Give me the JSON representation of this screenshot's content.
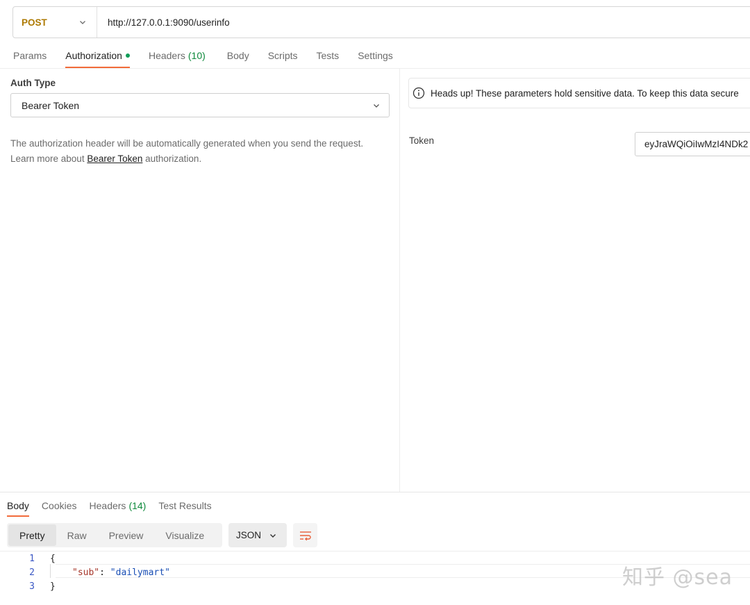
{
  "request": {
    "method": "POST",
    "url": "http://127.0.0.1:9090/userinfo"
  },
  "request_tabs": [
    {
      "label": "Params"
    },
    {
      "label": "Authorization",
      "active": true,
      "indicator": "green-dot"
    },
    {
      "label": "Headers",
      "count": "(10)"
    },
    {
      "label": "Body"
    },
    {
      "label": "Scripts"
    },
    {
      "label": "Tests"
    },
    {
      "label": "Settings"
    }
  ],
  "auth": {
    "type_label": "Auth Type",
    "type_value": "Bearer Token",
    "help_line1": "The authorization header will be automatically generated when you send the request.",
    "help_prefix": "Learn more about ",
    "help_link": "Bearer Token",
    "help_suffix": " authorization.",
    "notice": "Heads up! These parameters hold sensitive data. To keep this data secure",
    "token_label": "Token",
    "token_value": "eyJraWQiOiIwMzI4NDk2"
  },
  "response_tabs": [
    {
      "label": "Body",
      "active": true
    },
    {
      "label": "Cookies"
    },
    {
      "label": "Headers",
      "count": "(14)"
    },
    {
      "label": "Test Results"
    }
  ],
  "view_modes": [
    {
      "label": "Pretty",
      "active": true
    },
    {
      "label": "Raw"
    },
    {
      "label": "Preview"
    },
    {
      "label": "Visualize"
    }
  ],
  "format": "JSON",
  "code": {
    "line_numbers": [
      "1",
      "2",
      "3"
    ],
    "open_brace": "{",
    "key": "\"sub\"",
    "colon": ": ",
    "value": "\"dailymart\"",
    "close_brace": "}"
  },
  "watermark": "知乎 @sea",
  "colors": {
    "method": "#ad7a03",
    "active_tab_underline": "#f26b3a",
    "count_green": "#0f8a3c",
    "json_key": "#a6362a",
    "json_string": "#1a4fb5"
  },
  "icons": [
    "chevron-down-icon",
    "info-icon",
    "wrap-lines-icon"
  ]
}
